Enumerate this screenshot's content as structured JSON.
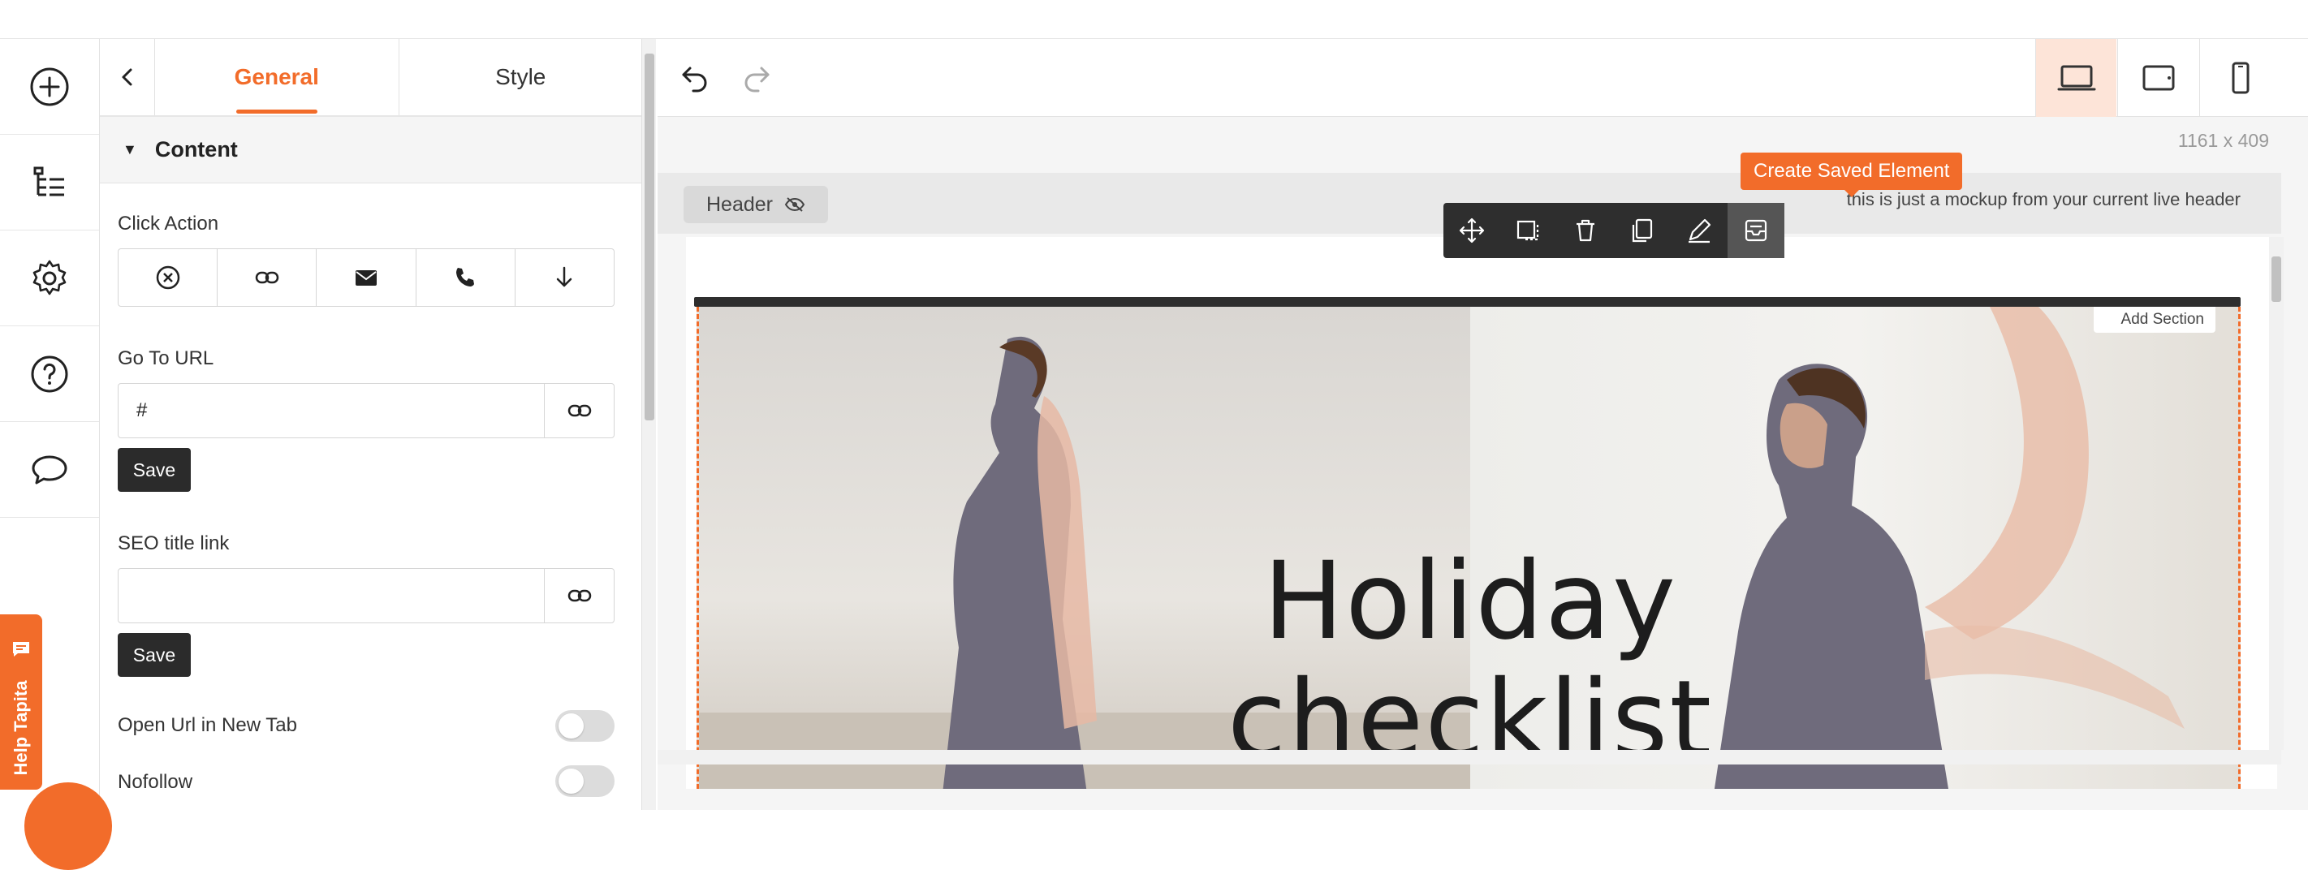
{
  "rail": {
    "items": [
      {
        "icon": "add-icon"
      },
      {
        "icon": "layers-tree-icon"
      },
      {
        "icon": "gear-icon"
      },
      {
        "icon": "help-icon"
      },
      {
        "icon": "chat-icon"
      }
    ]
  },
  "panel": {
    "tabs": [
      {
        "label": "General",
        "active": true
      },
      {
        "label": "Style",
        "active": false
      }
    ],
    "section_title": "Content",
    "click_action": {
      "label": "Click Action",
      "options": [
        "none-icon",
        "link-icon",
        "email-icon",
        "phone-icon",
        "arrow-down-icon"
      ]
    },
    "go_to_url": {
      "label": "Go To URL",
      "value": "#",
      "save_label": "Save"
    },
    "seo_title_link": {
      "label": "SEO title link",
      "value": "",
      "save_label": "Save"
    },
    "open_new_tab": {
      "label": "Open Url in New Tab",
      "on": false
    },
    "nofollow": {
      "label": "Nofollow",
      "on": false
    }
  },
  "help": {
    "label": "Help Tapita"
  },
  "canvas": {
    "dimensions": "1161 x 409",
    "header_label": "Header",
    "mockup_note": "this is just a mockup from your current live header",
    "tooltip": "Create Saved Element",
    "element_tools": [
      "move-icon",
      "resize-icon",
      "trash-icon",
      "duplicate-icon",
      "edit-icon",
      "save-element-icon"
    ],
    "add_section": "Add Section",
    "hero_title_line1": "Holiday",
    "hero_title_line2": "checklist",
    "devices": [
      "desktop-icon",
      "tablet-icon",
      "mobile-icon"
    ]
  },
  "colors": {
    "accent": "#f26c2a",
    "dark": "#2e2e2e"
  }
}
